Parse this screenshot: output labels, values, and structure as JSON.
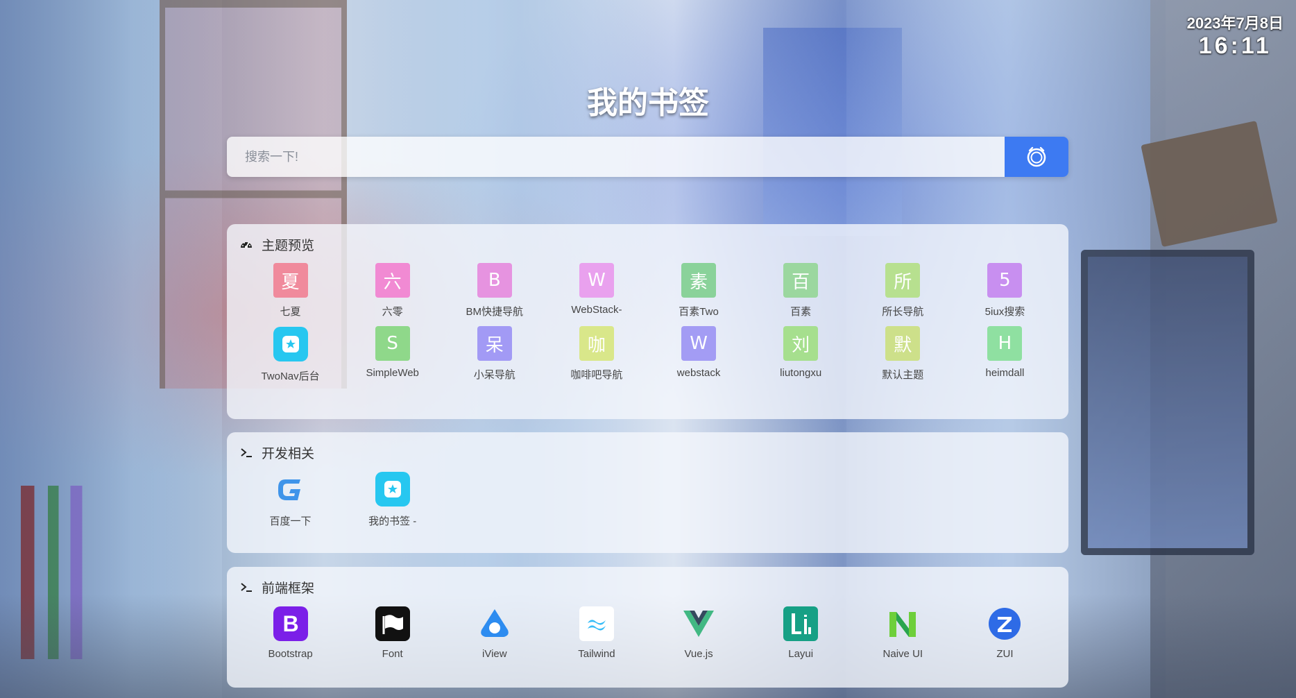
{
  "clock": {
    "date": "2023年7月8日",
    "time": "16:11"
  },
  "page": {
    "title": "我的书签"
  },
  "search": {
    "placeholder": "搜索一下!"
  },
  "sections": [
    {
      "title": "主题预览",
      "icon": "dashboard-icon",
      "items": [
        {
          "char": "夏",
          "label": "七夏",
          "color": "#f08a9c"
        },
        {
          "char": "六",
          "label": "六零",
          "color": "#f18ad3"
        },
        {
          "char": "B",
          "label": "BM快捷导航",
          "color": "#e693e0"
        },
        {
          "char": "W",
          "label": "WebStack-",
          "color": "#e9a1ee"
        },
        {
          "char": "素",
          "label": "百素Two",
          "color": "#8ad29a"
        },
        {
          "char": "百",
          "label": "百素",
          "color": "#9bd79f"
        },
        {
          "char": "所",
          "label": "所长导航",
          "color": "#b7e08f"
        },
        {
          "char": "5",
          "label": "5iux搜索",
          "color": "#c88ff0"
        },
        {
          "char": "",
          "label": "TwoNav后台",
          "color": "#27c7f0",
          "kind": "twonav"
        },
        {
          "char": "S",
          "label": "SimpleWeb",
          "color": "#8fd88a"
        },
        {
          "char": "呆",
          "label": "小呆导航",
          "color": "#a29af5"
        },
        {
          "char": "咖",
          "label": "咖啡吧导航",
          "color": "#d9e78a"
        },
        {
          "char": "W",
          "label": "webstack",
          "color": "#a39cf4"
        },
        {
          "char": "刘",
          "label": "liutongxu",
          "color": "#a6df8e"
        },
        {
          "char": "默",
          "label": "默认主题",
          "color": "#cde08a"
        },
        {
          "char": "H",
          "label": "heimdall",
          "color": "#8fe0a1"
        }
      ]
    },
    {
      "title": "开发相关",
      "icon": "terminal-icon",
      "items": [
        {
          "char": "",
          "label": "百度一下",
          "color": "#2c8ae8",
          "kind": "gicon"
        },
        {
          "char": "",
          "label": "我的书签 -",
          "color": "#27c7f0",
          "kind": "twonav"
        }
      ]
    },
    {
      "title": "前端框架",
      "icon": "terminal-icon",
      "items": [
        {
          "char": "",
          "label": "Bootstrap",
          "color": "#7b1fe8",
          "kind": "bootstrap"
        },
        {
          "char": "",
          "label": "Font",
          "color": "#111111",
          "kind": "flag"
        },
        {
          "char": "",
          "label": "iView",
          "color": "#2d8cf0",
          "kind": "iview"
        },
        {
          "char": "",
          "label": "Tailwind",
          "color": "#38bdf8",
          "kind": "tailwind"
        },
        {
          "char": "",
          "label": "Vue.js",
          "color": "#41b883",
          "kind": "vue"
        },
        {
          "char": "",
          "label": "Layui",
          "color": "#16a085",
          "kind": "layui"
        },
        {
          "char": "",
          "label": "Naive UI",
          "color": "#6ecf3b",
          "kind": "naive"
        },
        {
          "char": "",
          "label": "ZUI",
          "color": "#2e6be6",
          "kind": "zui"
        }
      ]
    }
  ]
}
